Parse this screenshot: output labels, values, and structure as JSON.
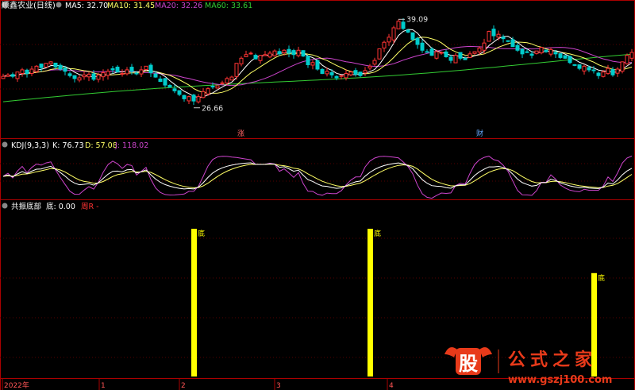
{
  "stock": {
    "title": "顺鑫农业(日线)",
    "ma_labels": [
      {
        "text": "MA5: 32.70",
        "color": "#ffffff"
      },
      {
        "text": "MA10: 31.45",
        "color": "#ffff66"
      },
      {
        "text": "MA20: 32.26",
        "color": "#cc44cc"
      },
      {
        "text": "MA60: 33.61",
        "color": "#33cc33"
      }
    ],
    "high_label": "39.09",
    "low_label": "26.66",
    "event_markers": [
      {
        "text": "涨",
        "color": "#ff6666"
      },
      {
        "text": "财",
        "color": "#66aaff"
      }
    ]
  },
  "kdj": {
    "title": "KDJ(9,3,3)",
    "labels": [
      {
        "text": "K: 76.73",
        "color": "#ffffff"
      },
      {
        "text": "D: 57.08",
        "color": "#ffff66"
      },
      {
        "text": "J: 118.02",
        "color": "#cc44cc"
      }
    ]
  },
  "indicator": {
    "title": "共振底部",
    "value_label": "底: 0.00",
    "extra_label": "周R -",
    "bar_label": "底"
  },
  "x_axis": {
    "labels": [
      "2022年",
      "1",
      "2",
      "3",
      "4"
    ]
  },
  "watermark": {
    "logo_char": "股",
    "text": "公式之家",
    "url": "www.gszj100.com"
  },
  "colors": {
    "up": "#ff3333",
    "down": "#00cccc",
    "border": "#aa0000",
    "signal": "#ffff00"
  },
  "chart_data": [
    {
      "type": "candlestick",
      "title": "顺鑫农业(日线)",
      "ylim": [
        24,
        40
      ],
      "x": [
        0,
        1,
        2,
        3,
        4,
        5,
        6,
        7,
        8,
        9,
        10,
        11,
        12,
        13,
        14,
        15,
        16,
        17,
        18,
        19,
        20,
        21,
        22,
        23,
        24,
        25,
        26,
        27,
        28,
        29,
        30,
        31,
        32,
        33,
        34,
        35,
        36,
        37,
        38,
        39,
        40,
        41,
        42,
        43,
        44,
        45,
        46,
        47,
        48,
        49,
        50,
        51,
        52,
        53,
        54,
        55,
        56,
        57,
        58,
        59,
        60,
        61,
        62,
        63,
        64,
        65,
        66,
        67,
        68,
        69,
        70,
        71,
        72,
        73,
        74,
        75,
        76,
        77,
        78,
        79,
        80,
        81,
        82,
        83,
        84,
        85,
        86,
        87,
        88,
        89,
        90,
        91,
        92,
        93,
        94,
        95,
        96,
        97,
        98,
        99,
        100,
        101,
        102,
        103,
        104,
        105,
        106,
        107,
        108,
        109,
        110,
        111,
        112,
        113,
        114,
        115,
        116,
        117,
        118,
        119,
        120,
        121,
        122,
        123,
        124,
        125,
        126,
        127,
        128,
        129,
        130,
        131,
        132
      ],
      "close": [
        31.0,
        31.2,
        31.0,
        31.6,
        31.9,
        31.4,
        32.0,
        32.4,
        32.2,
        32.8,
        33.0,
        32.3,
        32.0,
        31.7,
        31.1,
        30.7,
        30.8,
        31.2,
        31.3,
        30.6,
        31.2,
        31.5,
        31.7,
        31.9,
        31.6,
        31.4,
        31.9,
        31.7,
        31.4,
        31.9,
        32.4,
        31.5,
        30.9,
        30.3,
        29.8,
        29.5,
        29.0,
        28.5,
        27.9,
        28.2,
        27.6,
        28.2,
        28.9,
        29.3,
        29.6,
        29.7,
        30.1,
        30.7,
        30.9,
        32.8,
        33.5,
        34.0,
        34.2,
        33.4,
        33.9,
        34.0,
        34.2,
        34.5,
        34.1,
        34.6,
        34.2,
        34.0,
        34.6,
        33.8,
        32.6,
        32.9,
        32.0,
        31.4,
        31.7,
        31.2,
        30.8,
        31.1,
        31.4,
        31.6,
        31.3,
        31.1,
        31.8,
        32.4,
        33.2,
        34.8,
        35.7,
        36.4,
        37.7,
        38.6,
        37.6,
        37.1,
        36.1,
        35.4,
        34.6,
        34.4,
        33.9,
        34.4,
        34.3,
        33.7,
        33.2,
        33.9,
        33.5,
        33.3,
        34.1,
        34.4,
        34.9,
        35.6,
        37.2,
        36.6,
        36.8,
        36.2,
        35.9,
        35.1,
        34.6,
        34.1,
        34.3,
        33.9,
        34.5,
        35.0,
        34.4,
        34.7,
        34.1,
        33.6,
        33.5,
        32.9,
        32.6,
        32.1,
        32.4,
        31.9,
        31.8,
        31.1,
        31.6,
        32.1,
        31.2,
        32.0,
        33.0,
        33.9,
        34.3
      ],
      "high_label": 39.09,
      "low_label": 26.66,
      "series": [
        {
          "name": "MA5",
          "last": 32.7
        },
        {
          "name": "MA10",
          "last": 31.45
        },
        {
          "name": "MA20",
          "last": 32.26
        },
        {
          "name": "MA60",
          "last": 33.61
        }
      ]
    },
    {
      "type": "line",
      "title": "KDJ(9,3,3)",
      "ylim": [
        -20,
        130
      ],
      "series": [
        {
          "name": "K",
          "last": 76.73
        },
        {
          "name": "D",
          "last": 57.08
        },
        {
          "name": "J",
          "last": 118.02
        }
      ]
    },
    {
      "type": "bar",
      "title": "共振底部",
      "x": [
        40,
        77,
        124
      ],
      "values": [
        1,
        1,
        0.7
      ],
      "label": "底"
    }
  ]
}
